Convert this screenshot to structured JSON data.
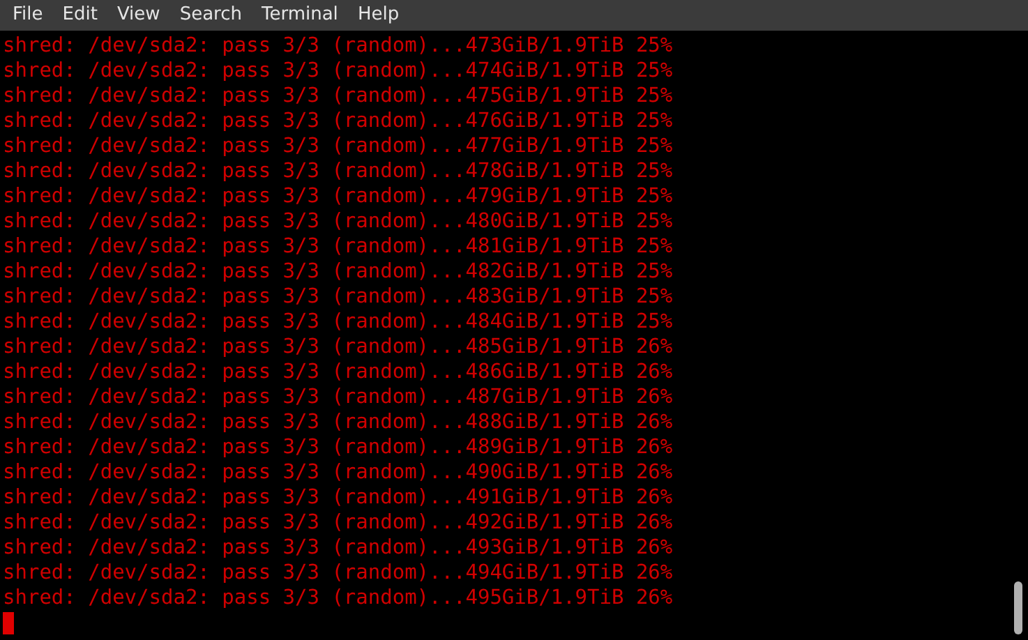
{
  "menu": [
    "File",
    "Edit",
    "View",
    "Search",
    "Terminal",
    "Help"
  ],
  "terminal_lines": [
    "shred: /dev/sda2: pass 3/3 (random)...473GiB/1.9TiB 25%",
    "shred: /dev/sda2: pass 3/3 (random)...474GiB/1.9TiB 25%",
    "shred: /dev/sda2: pass 3/3 (random)...475GiB/1.9TiB 25%",
    "shred: /dev/sda2: pass 3/3 (random)...476GiB/1.9TiB 25%",
    "shred: /dev/sda2: pass 3/3 (random)...477GiB/1.9TiB 25%",
    "shred: /dev/sda2: pass 3/3 (random)...478GiB/1.9TiB 25%",
    "shred: /dev/sda2: pass 3/3 (random)...479GiB/1.9TiB 25%",
    "shred: /dev/sda2: pass 3/3 (random)...480GiB/1.9TiB 25%",
    "shred: /dev/sda2: pass 3/3 (random)...481GiB/1.9TiB 25%",
    "shred: /dev/sda2: pass 3/3 (random)...482GiB/1.9TiB 25%",
    "shred: /dev/sda2: pass 3/3 (random)...483GiB/1.9TiB 25%",
    "shred: /dev/sda2: pass 3/3 (random)...484GiB/1.9TiB 25%",
    "shred: /dev/sda2: pass 3/3 (random)...485GiB/1.9TiB 26%",
    "shred: /dev/sda2: pass 3/3 (random)...486GiB/1.9TiB 26%",
    "shred: /dev/sda2: pass 3/3 (random)...487GiB/1.9TiB 26%",
    "shred: /dev/sda2: pass 3/3 (random)...488GiB/1.9TiB 26%",
    "shred: /dev/sda2: pass 3/3 (random)...489GiB/1.9TiB 26%",
    "shred: /dev/sda2: pass 3/3 (random)...490GiB/1.9TiB 26%",
    "shred: /dev/sda2: pass 3/3 (random)...491GiB/1.9TiB 26%",
    "shred: /dev/sda2: pass 3/3 (random)...492GiB/1.9TiB 26%",
    "shred: /dev/sda2: pass 3/3 (random)...493GiB/1.9TiB 26%",
    "shred: /dev/sda2: pass 3/3 (random)...494GiB/1.9TiB 26%",
    "shred: /dev/sda2: pass 3/3 (random)...495GiB/1.9TiB 26%"
  ]
}
